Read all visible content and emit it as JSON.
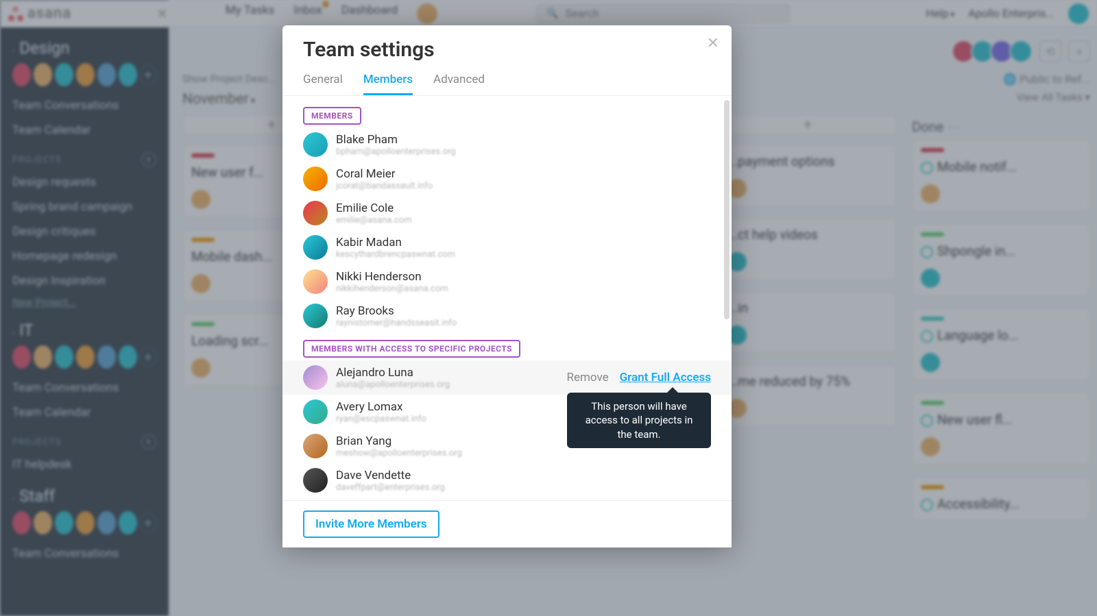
{
  "top": {
    "brand": "asana",
    "nav": {
      "my_tasks": "My Tasks",
      "inbox": "Inbox",
      "dashboard": "Dashboard"
    },
    "search_placeholder": "Search",
    "help": "Help",
    "org": "Apollo Enterpris..."
  },
  "sidebar": {
    "teams": [
      {
        "name": "Design",
        "links": {
          "conv": "Team Conversations",
          "cal": "Team Calendar"
        },
        "projects_label": "PROJECTS",
        "projects": [
          "Design requests",
          "Spring brand campaign",
          "Design critiques",
          "Homepage redesign",
          "Design Inspiration"
        ],
        "new_project": "New Project..."
      },
      {
        "name": "IT",
        "links": {
          "conv": "Team Conversations",
          "cal": "Team Calendar"
        },
        "projects_label": "PROJECTS",
        "projects": [
          "IT helpdesk"
        ]
      },
      {
        "name": "Staff",
        "links": {
          "conv": "Team Conversations"
        }
      }
    ]
  },
  "board": {
    "desc": "Show Project Desc...",
    "view_all": "View All Tasks ▾",
    "month": "November",
    "public": "Public to Ref...",
    "columns": [
      {
        "title": "",
        "cards": [
          {
            "bar": "red",
            "title": "New user f..."
          },
          {
            "bar": "orange",
            "title": "Mobile dash..."
          },
          {
            "bar": "green",
            "title": "Loading scr..."
          }
        ]
      },
      {
        "title": "",
        "cards": [
          {
            "bar": "",
            "title": "...payment options"
          },
          {
            "bar": "",
            "title": "...ct help videos"
          },
          {
            "bar": "",
            "title": "...in"
          },
          {
            "bar": "",
            "title": "...me reduced by 75%"
          }
        ]
      },
      {
        "title": "Done",
        "cards": [
          {
            "bar": "red",
            "title": "Mobile notif...",
            "check": true
          },
          {
            "bar": "green",
            "title": "Shpongle in...",
            "check": true
          },
          {
            "bar": "cyan",
            "title": "Language lo...",
            "check": true
          },
          {
            "bar": "green",
            "title": "New user fl...",
            "check": true
          },
          {
            "bar": "orange",
            "title": "Accessibility...",
            "check": true
          }
        ]
      }
    ]
  },
  "modal": {
    "title": "Team settings",
    "tabs": {
      "general": "General",
      "members": "Members",
      "advanced": "Advanced"
    },
    "section_members": "MEMBERS",
    "section_guests": "MEMBERS WITH ACCESS TO SPECIFIC PROJECTS",
    "members": [
      {
        "name": "Blake Pham",
        "email": "bpham@apolloenterprises.org"
      },
      {
        "name": "Coral Meier",
        "email": "jcorat@bandassault.info"
      },
      {
        "name": "Emilie Cole",
        "email": "emilie@asana.com"
      },
      {
        "name": "Kabir Madan",
        "email": "kescythardbrencpaswnat.com"
      },
      {
        "name": "Nikki Henderson",
        "email": "nikkihenderson@asana.com"
      },
      {
        "name": "Ray Brooks",
        "email": "raynistomer@handsseasit.info"
      }
    ],
    "guests": [
      {
        "name": "Alejandro Luna",
        "email": "aluna@apolloenterprises.org",
        "hover": true
      },
      {
        "name": "Avery Lomax",
        "email": "ryan@escpaswnat.info"
      },
      {
        "name": "Brian Yang",
        "email": "meshow@apolloenterprises.org"
      },
      {
        "name": "Dave Vendette",
        "email": "daveffpart@enterprises.org"
      }
    ],
    "actions": {
      "remove": "Remove",
      "grant": "Grant Full Access"
    },
    "tooltip": "This person will have access to all projects in the team.",
    "invite": "Invite More Members"
  }
}
